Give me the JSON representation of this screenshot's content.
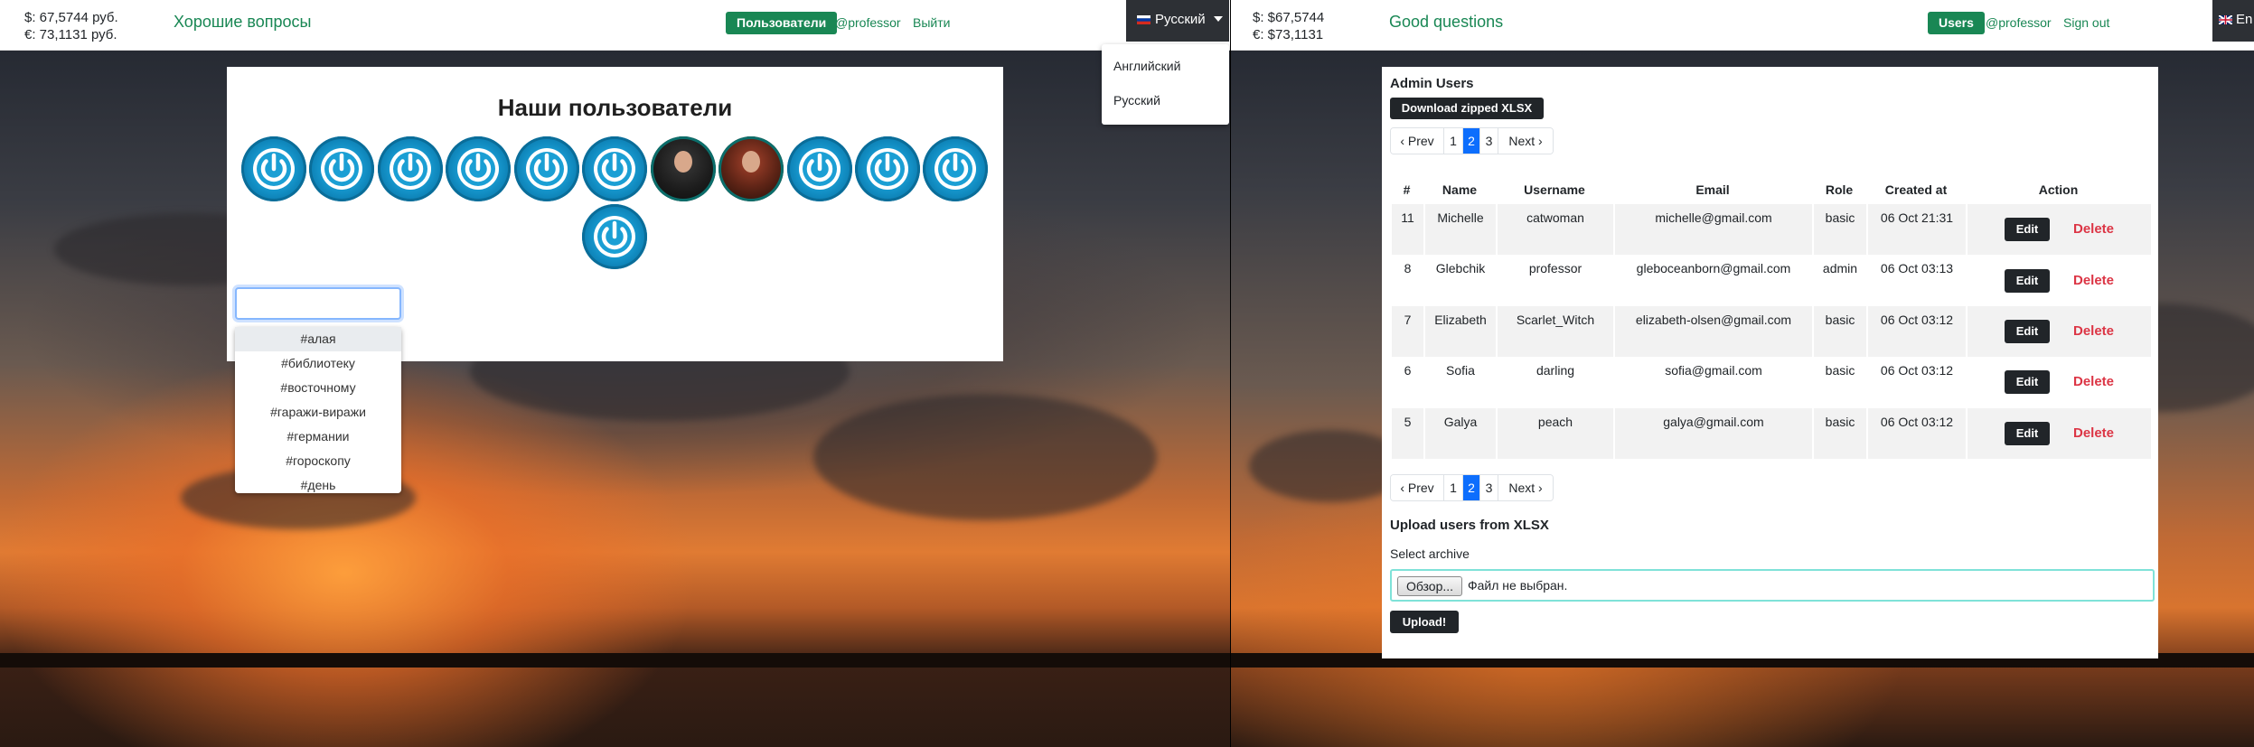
{
  "left": {
    "rates": {
      "usd": "$: 67,5744 руб.",
      "eur": "€: 73,1131 руб."
    },
    "brand": "Хорошие вопросы",
    "nav": {
      "users": "Пользователи",
      "profile": "@professor",
      "logout": "Выйти"
    },
    "language": {
      "current": "Русский",
      "menu": [
        "Английский",
        "Русский"
      ]
    },
    "title": "Наши пользователи",
    "avatars": [
      {
        "icon": "power-icon"
      },
      {
        "icon": "power-icon"
      },
      {
        "icon": "power-icon"
      },
      {
        "icon": "power-icon"
      },
      {
        "icon": "power-icon"
      },
      {
        "icon": "power-icon"
      },
      {
        "icon": "user-photo"
      },
      {
        "icon": "user-photo"
      },
      {
        "icon": "power-icon"
      },
      {
        "icon": "power-icon"
      },
      {
        "icon": "power-icon"
      },
      {
        "icon": "power-icon"
      }
    ],
    "tag_input": {
      "value": ""
    },
    "suggestions": [
      "#алая",
      "#библиотеку",
      "#восточному",
      "#гаражи-виражи",
      "#германии",
      "#гороскопу",
      "#день"
    ]
  },
  "right": {
    "rates": {
      "usd": "$: $67,5744",
      "eur": "€: $73,1131"
    },
    "brand": "Good questions",
    "nav": {
      "users": "Users",
      "profile": "@professor",
      "logout": "Sign out"
    },
    "language_cut": "En",
    "heading": "Admin Users",
    "download_button": "Download zipped XLSX",
    "pagination": {
      "prev": "‹ Prev",
      "pages": [
        "1",
        "2",
        "3"
      ],
      "active": "2",
      "next": "Next ›"
    },
    "columns": [
      "#",
      "Name",
      "Username",
      "Email",
      "Role",
      "Created at",
      "Action"
    ],
    "rows": [
      {
        "id": "11",
        "name": "Michelle",
        "username": "catwoman",
        "email": "michelle@gmail.com",
        "role": "basic",
        "created": "06 Oct 21:31"
      },
      {
        "id": "8",
        "name": "Glebchik",
        "username": "professor",
        "email": "gleboceanborn@gmail.com",
        "role": "admin",
        "created": "06 Oct 03:13"
      },
      {
        "id": "7",
        "name": "Elizabeth",
        "username": "Scarlet_Witch",
        "email": "elizabeth-olsen@gmail.com",
        "role": "basic",
        "created": "06 Oct 03:12"
      },
      {
        "id": "6",
        "name": "Sofia",
        "username": "darling",
        "email": "sofia@gmail.com",
        "role": "basic",
        "created": "06 Oct 03:12"
      },
      {
        "id": "5",
        "name": "Galya",
        "username": "peach",
        "email": "galya@gmail.com",
        "role": "basic",
        "created": "06 Oct 03:12"
      }
    ],
    "edit_label": "Edit",
    "delete_label": "Delete",
    "upload_heading": "Upload users from XLSX",
    "select_label": "Select archive",
    "browse_button": "Обзор...",
    "no_file": "Файл не выбран.",
    "upload_button": "Upload!"
  },
  "colors": {
    "brand": "#198754",
    "active_page": "#0d6efd",
    "delete": "#dc3545",
    "dark": "#212529"
  }
}
